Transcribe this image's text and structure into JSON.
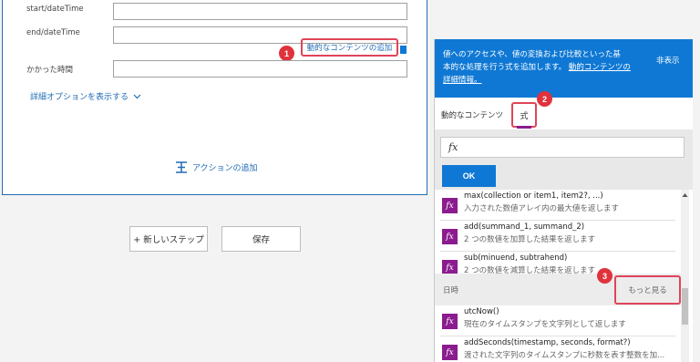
{
  "form": {
    "start_label": "start/dateTime",
    "end_label": "end/dateTime",
    "elapsed_label": "かかった時間",
    "dynamic_content_link": "動的なコンテンツの追加",
    "advanced_options": "詳細オプションを表示する",
    "add_action": "アクションの追加"
  },
  "buttons": {
    "new_step": "+ 新しいステップ",
    "save": "保存"
  },
  "badges": {
    "one": "1",
    "two": "2",
    "three": "3"
  },
  "panel": {
    "info_text_1": "値へのアクセスや、値の変換および比較といった基",
    "info_text_2": "本的な処理を行う式を追加します。",
    "info_link_1": "動的コンテンツの",
    "info_link_2": "詳細情報。",
    "hide": "非表示",
    "tab_dynamic": "動的なコンテンツ",
    "tab_expression": "式",
    "fx_symbol": "fx",
    "ok": "OK",
    "functions_top": [
      {
        "name": "max(collection or item1, item2?, ...)",
        "desc": "入力された数値アレイ内の最大値を返します"
      },
      {
        "name": "add(summand_1, summand_2)",
        "desc": "2 つの数値を加算した結果を返します"
      },
      {
        "name": "sub(minuend, subtrahend)",
        "desc": "2 つの数値を減算した結果を返します"
      }
    ],
    "section_label": "日時",
    "see_more": "もっと見る",
    "functions_bottom": [
      {
        "name": "utcNow()",
        "desc": "現在のタイムスタンプを文字列として返します"
      },
      {
        "name": "addSeconds(timestamp, seconds, format?)",
        "desc": "渡された文字列のタイムスタンプに秒数を表す整数を加..."
      }
    ]
  },
  "colors": {
    "accent": "#0f78d4",
    "highlight": "#e0445a",
    "fx_icon": "#8b1c8f"
  }
}
